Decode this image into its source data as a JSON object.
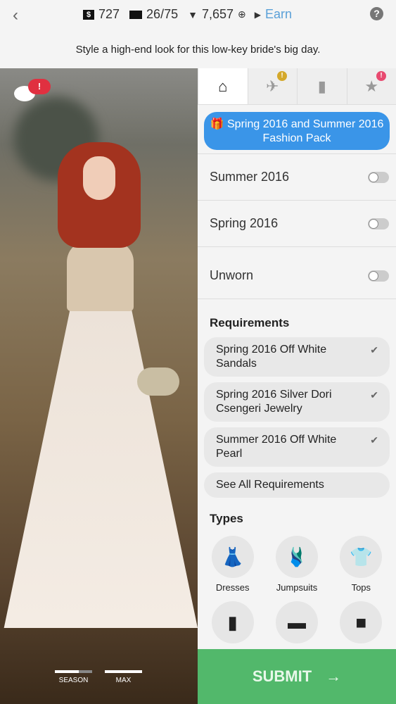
{
  "topbar": {
    "cash": "727",
    "tickets": "26/75",
    "diamonds": "7,657",
    "plus": "⊕",
    "earn": "Earn",
    "help": "?",
    "back": "‹"
  },
  "prompt": "Style a high-end look for this low-key bride's big day.",
  "scene": {
    "chat_badge": "!",
    "meters": [
      {
        "label": "SEASON",
        "fill": 0.65
      },
      {
        "label": "MAX",
        "fill": 1.0
      }
    ]
  },
  "tabs": [
    {
      "icon": "hanger-icon",
      "active": true
    },
    {
      "icon": "hairdryer-icon",
      "badge": "!",
      "badge_color": "#d4a82a"
    },
    {
      "icon": "lipstick-icon"
    },
    {
      "icon": "star-wand-icon",
      "badge": "!",
      "badge_color": "#e84a70"
    }
  ],
  "pack_button": "🎁 Spring 2016 and Summer 2016 Fashion Pack",
  "filters": [
    {
      "label": "Summer 2016",
      "on": false
    },
    {
      "label": "Spring 2016",
      "on": false
    },
    {
      "label": "Unworn",
      "on": false
    }
  ],
  "requirements": {
    "title": "Requirements",
    "items": [
      "Spring 2016 Off White Sandals",
      "Spring 2016 Silver Dori Csengeri Jewelry",
      "Summer 2016 Off White Pearl"
    ],
    "see_all": "See All Requirements"
  },
  "types": {
    "title": "Types",
    "items": [
      {
        "label": "Dresses",
        "glyph": "👗"
      },
      {
        "label": "Jumpsuits",
        "glyph": "🩱"
      },
      {
        "label": "Tops",
        "glyph": "👕"
      }
    ]
  },
  "submit": "SUBMIT",
  "submit_arrow": "→",
  "colors": {
    "accent": "#3a95e8",
    "submit": "#52b86b",
    "alert": "#e03040"
  }
}
